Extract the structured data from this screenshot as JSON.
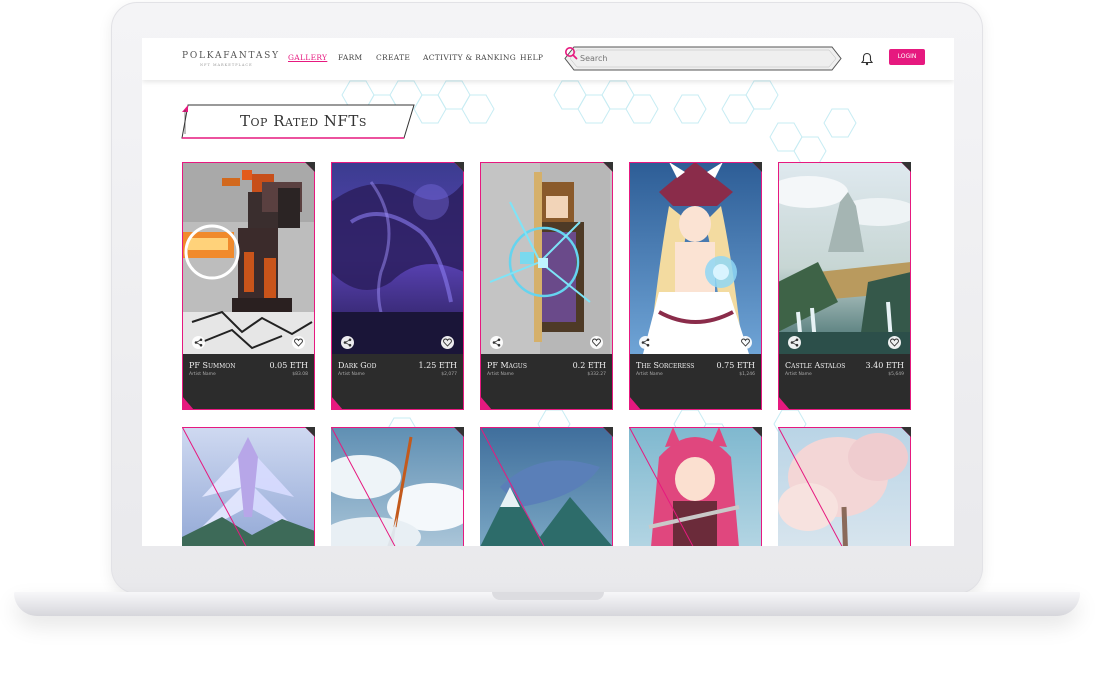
{
  "brand": {
    "logo": "POLKAFANTASY",
    "tagline": "NFT MARKETPLACE"
  },
  "nav": {
    "links": [
      {
        "label": "GALLERY",
        "active": true
      },
      {
        "label": "FARM",
        "active": false
      },
      {
        "label": "CREATE",
        "active": false
      },
      {
        "label": "ACTIVITY & RANKING",
        "active": false
      },
      {
        "label": "HELP",
        "active": false
      }
    ],
    "search_placeholder": "Search",
    "login_label": "LOGIN"
  },
  "section_title": "Top Rated NFTs",
  "colors": {
    "accent": "#e6197f",
    "card_info_bg": "#2c2c2c",
    "hex_outline": "#bfe8f0"
  },
  "cards": [
    {
      "name": "PF Summon",
      "artist": "Artist Name",
      "price": "0.05 ETH",
      "usd": "$83.08",
      "art": "pixel-demon"
    },
    {
      "name": "Dark God",
      "artist": "Artist Name",
      "price": "1.25 ETH",
      "usd": "$2,077",
      "art": "purple-dragon"
    },
    {
      "name": "PF Magus",
      "artist": "Artist Name",
      "price": "0.2 ETH",
      "usd": "$332.27",
      "art": "pixel-mage"
    },
    {
      "name": "The Sorceress",
      "artist": "Artist Name",
      "price": "0.75 ETH",
      "usd": "$1,246",
      "art": "anime-witch"
    },
    {
      "name": "Castle Astalos",
      "artist": "Artist Name",
      "price": "3.40 ETH",
      "usd": "$5,649",
      "art": "fantasy-castle"
    },
    {
      "art": "winged-angel"
    },
    {
      "art": "sky-sword"
    },
    {
      "art": "blue-whale"
    },
    {
      "art": "pink-catgirl"
    },
    {
      "art": "blossom-tree"
    }
  ]
}
